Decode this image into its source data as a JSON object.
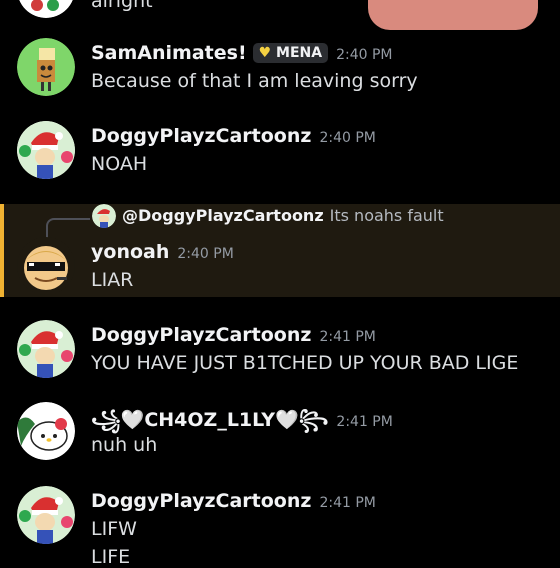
{
  "top_partial_text": "alright",
  "messages": [
    {
      "user": "SamAnimates!",
      "badge": "MENA",
      "time": "2:40 PM",
      "text": "Because of that I am leaving sorry"
    },
    {
      "user": "DoggyPlayzCartoonz",
      "time": "2:40 PM",
      "text": "NOAH"
    },
    {
      "reply_to_user": "@DoggyPlayzCartoonz",
      "reply_text": "Its noahs fault",
      "user": "yonoah",
      "time": "2:40 PM",
      "text": "LIAR"
    },
    {
      "user": "DoggyPlayzCartoonz",
      "time": "2:41 PM",
      "text": "YOU HAVE JUST B1TCHED UP YOUR BAD LIGE"
    },
    {
      "user": "꧁🤍CH4OZ_L1LY🤍꧂",
      "time": "2:41 PM",
      "text": "nuh uh"
    },
    {
      "user": "DoggyPlayzCartoonz",
      "time": "2:41 PM",
      "text": "LIFW",
      "text2": "LIFE"
    }
  ],
  "colors": {
    "highlight_bar": "#f0b232",
    "background": "#000000",
    "badge_heart": "#f5d142"
  },
  "icons": {
    "badge": "yellow-heart-icon"
  }
}
